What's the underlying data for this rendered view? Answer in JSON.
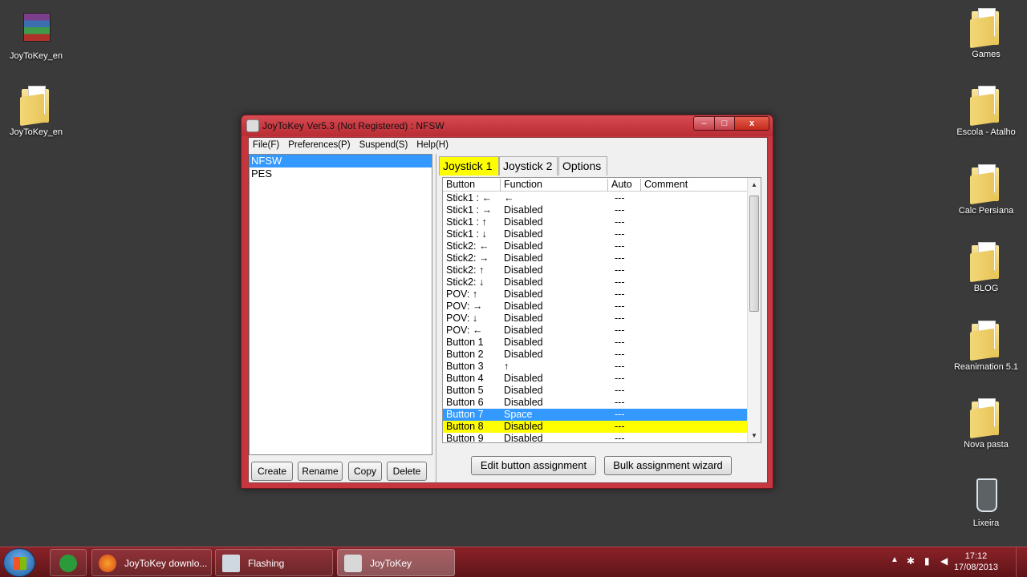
{
  "desktop": {
    "left_icons": [
      {
        "label": "JoyToKey_en",
        "icon": "winrar-archive-icon"
      },
      {
        "label": "JoyToKey_en",
        "icon": "folder-icon"
      }
    ],
    "right_icons": [
      {
        "label": "Games",
        "icon": "folder-icon"
      },
      {
        "label": "Escola - Atalho",
        "icon": "folder-shortcut-icon"
      },
      {
        "label": "Calc Persiana",
        "icon": "folder-icon"
      },
      {
        "label": "BLOG",
        "icon": "folder-icon"
      },
      {
        "label": "Reanimation 5.1",
        "icon": "folder-icon"
      },
      {
        "label": "Nova pasta",
        "icon": "folder-icon"
      },
      {
        "label": "Lixeira",
        "icon": "recycle-bin-icon"
      }
    ]
  },
  "window": {
    "title": "JoyToKey Ver5.3 (Not Registered) : NFSW",
    "minimize": "–",
    "maximize": "□",
    "close": "x",
    "menu": [
      "File(F)",
      "Preferences(P)",
      "Suspend(S)",
      "Help(H)"
    ],
    "profiles": [
      {
        "name": "NFSW",
        "selected": true
      },
      {
        "name": "PES",
        "selected": false
      }
    ],
    "profile_buttons": {
      "create": "Create",
      "rename": "Rename",
      "copy": "Copy",
      "delete": "Delete"
    },
    "tabs": [
      "Joystick 1",
      "Joystick 2",
      "Options"
    ],
    "grid_headers": {
      "button": "Button",
      "function": "Function",
      "auto": "Auto",
      "comment": "Comment"
    },
    "rows": [
      {
        "button": "Stick1 : ←",
        "function": "←",
        "auto": "---"
      },
      {
        "button": "Stick1 : →",
        "function": "Disabled",
        "auto": "---"
      },
      {
        "button": "Stick1 : ↑",
        "function": "Disabled",
        "auto": "---"
      },
      {
        "button": "Stick1 : ↓",
        "function": "Disabled",
        "auto": "---"
      },
      {
        "button": "Stick2: ←",
        "function": "Disabled",
        "auto": "---"
      },
      {
        "button": "Stick2: →",
        "function": "Disabled",
        "auto": "---"
      },
      {
        "button": "Stick2: ↑",
        "function": "Disabled",
        "auto": "---"
      },
      {
        "button": "Stick2: ↓",
        "function": "Disabled",
        "auto": "---"
      },
      {
        "button": "POV: ↑",
        "function": "Disabled",
        "auto": "---"
      },
      {
        "button": "POV: →",
        "function": "Disabled",
        "auto": "---"
      },
      {
        "button": "POV: ↓",
        "function": "Disabled",
        "auto": "---"
      },
      {
        "button": "POV: ←",
        "function": "Disabled",
        "auto": "---"
      },
      {
        "button": "Button 1",
        "function": "Disabled",
        "auto": "---"
      },
      {
        "button": "Button 2",
        "function": "Disabled",
        "auto": "---"
      },
      {
        "button": "Button 3",
        "function": "↑",
        "auto": "---"
      },
      {
        "button": "Button 4",
        "function": "Disabled",
        "auto": "---"
      },
      {
        "button": "Button 5",
        "function": "Disabled",
        "auto": "---"
      },
      {
        "button": "Button 6",
        "function": "Disabled",
        "auto": "---"
      },
      {
        "button": "Button 7",
        "function": "Space",
        "auto": "---",
        "highlight": "blue"
      },
      {
        "button": "Button 8",
        "function": "Disabled",
        "auto": "---",
        "highlight": "yellow"
      },
      {
        "button": "Button 9",
        "function": "Disabled",
        "auto": "---"
      }
    ],
    "edit_button": "Edit button assignment",
    "bulk_button": "Bulk assignment wizard"
  },
  "taskbar": {
    "items": [
      {
        "label": "",
        "icon": "utorrent-icon"
      },
      {
        "label": "JoyToKey downlo...",
        "icon": "firefox-icon"
      },
      {
        "label": "Flashing",
        "icon": "app-window-icon"
      },
      {
        "label": "JoyToKey",
        "icon": "joystick-icon",
        "active": true
      }
    ],
    "time": "17:12",
    "date": "17/08/2013"
  },
  "colors": {
    "titlebar": "#c7363e",
    "selection": "#3399ff",
    "highlight": "#ffff00",
    "taskbar": "#7a1c22"
  }
}
